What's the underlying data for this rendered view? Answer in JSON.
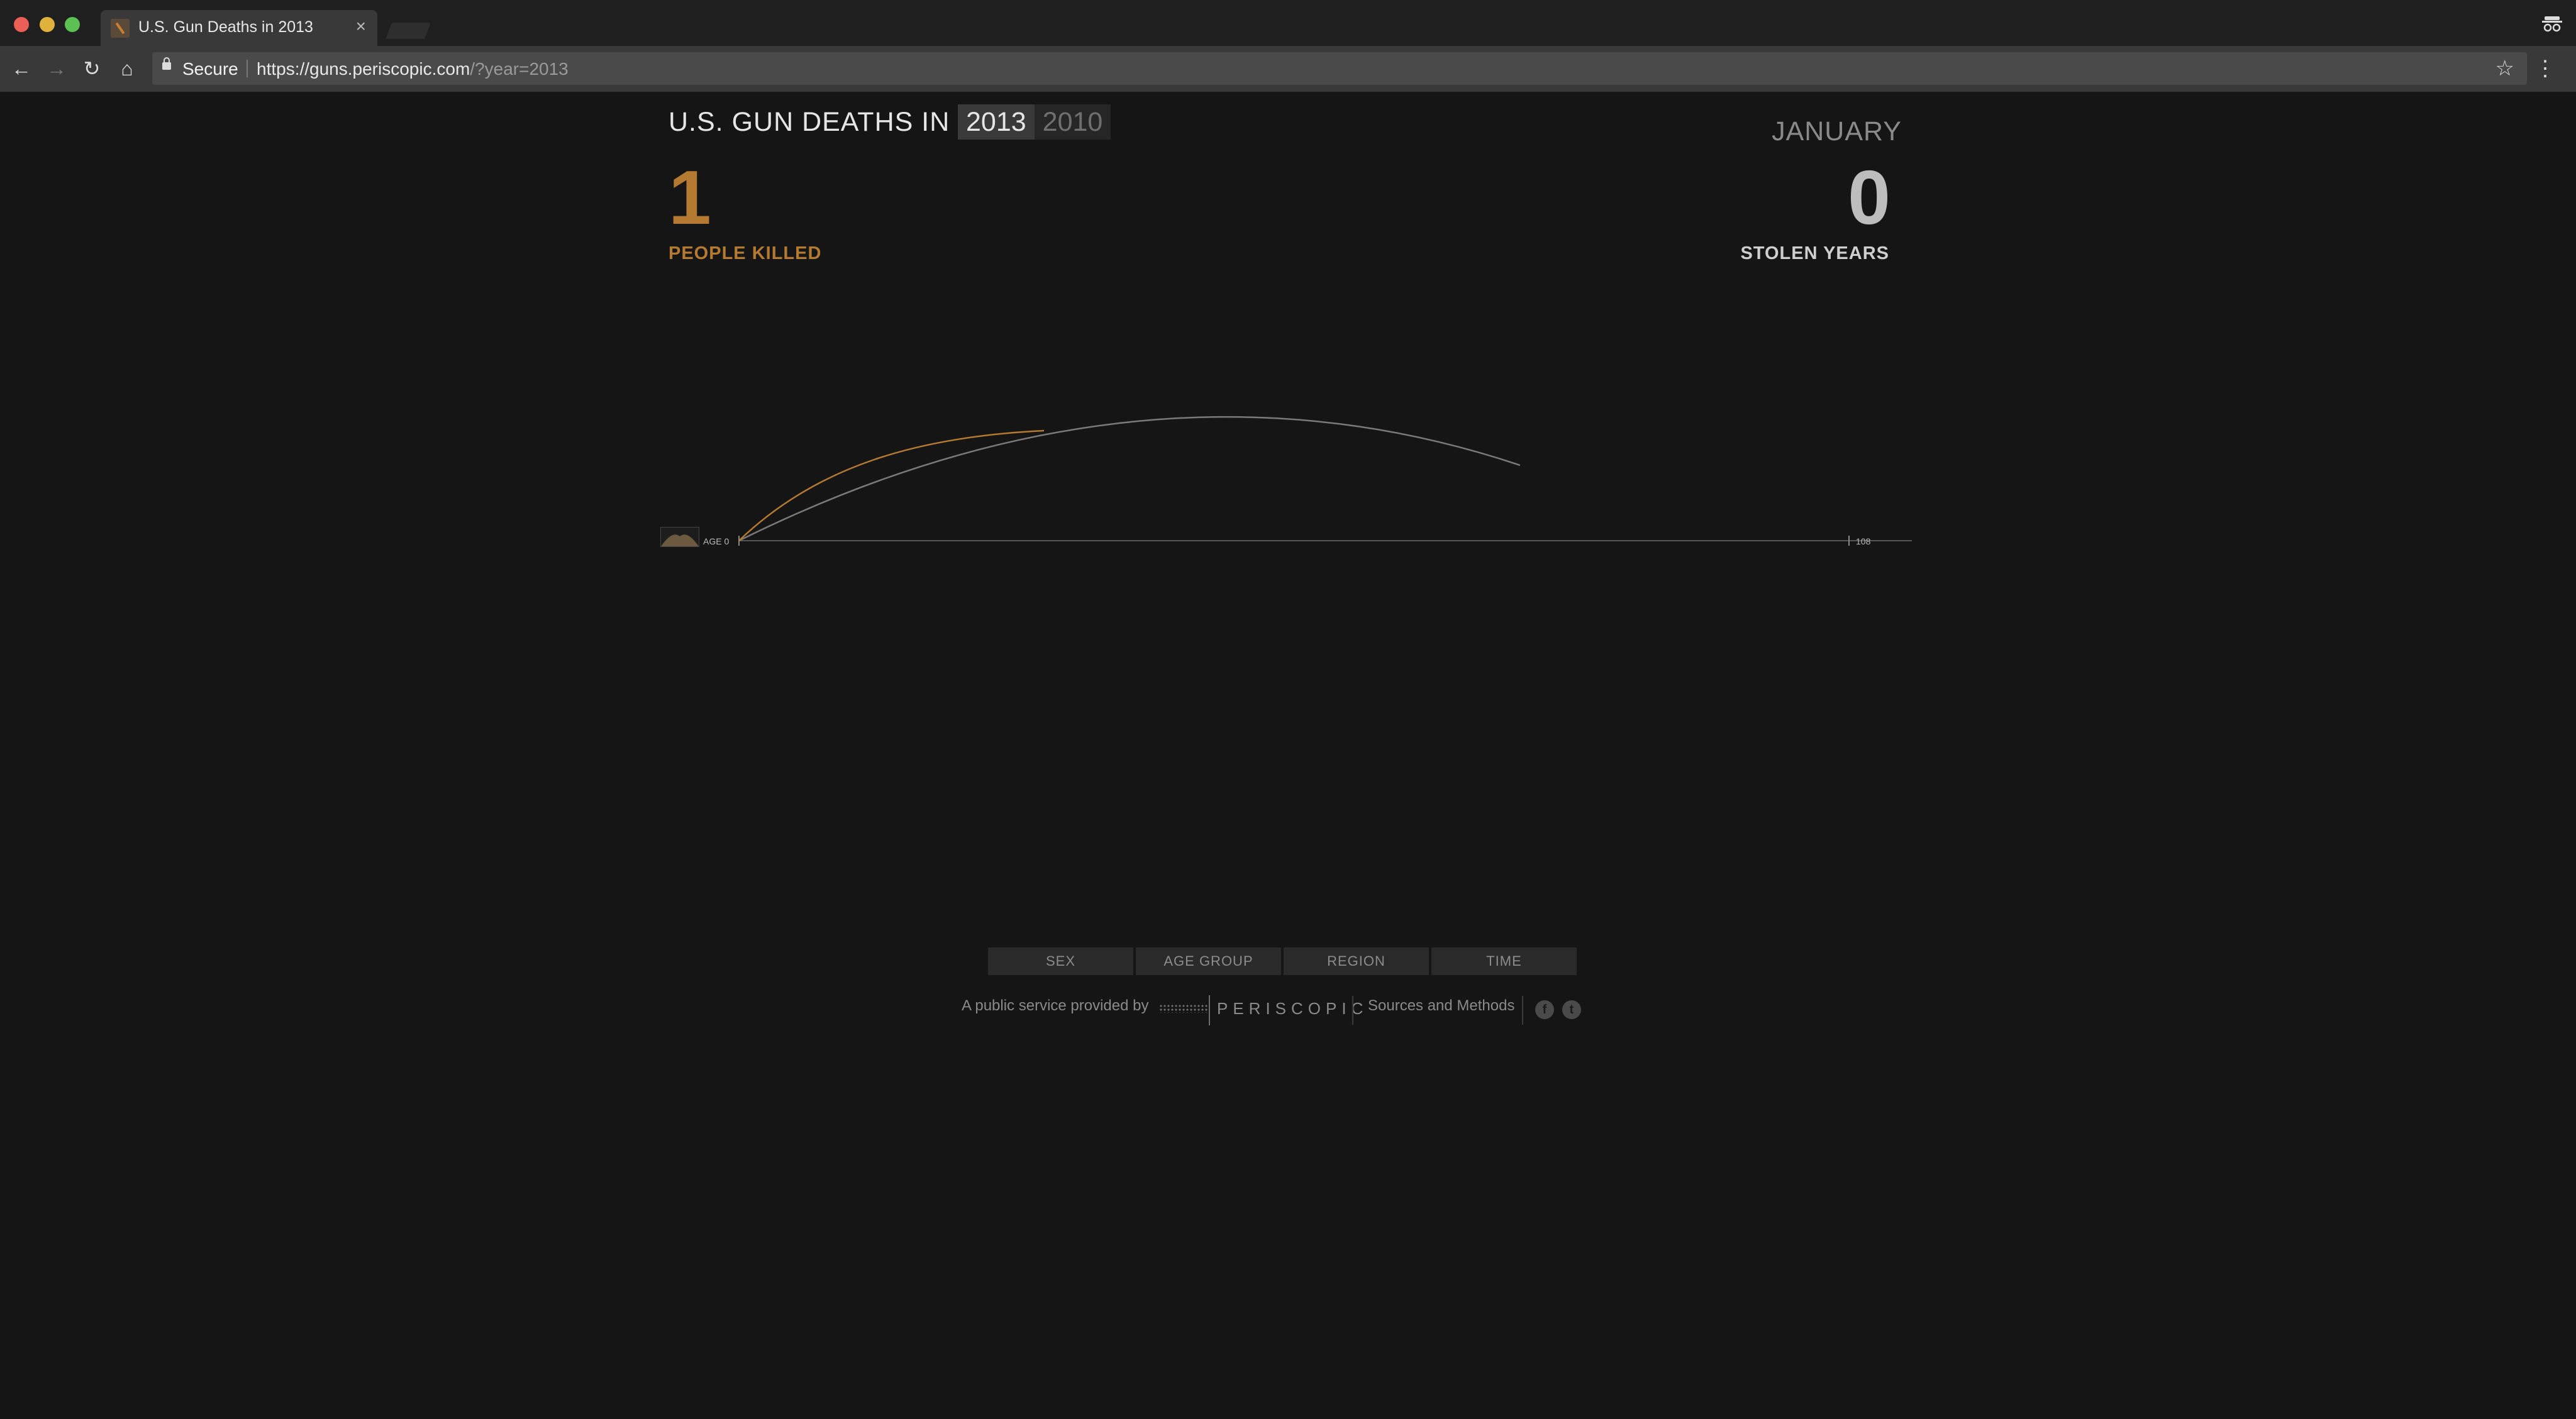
{
  "browser": {
    "tab_title": "U.S. Gun Deaths in 2013",
    "tab_close": "×",
    "secure_label": "Secure",
    "url_main": "https://guns.periscopic.com",
    "url_query": "/?year=2013"
  },
  "header": {
    "headline": "U.S. GUN DEATHS IN",
    "years": [
      "2013",
      "2010"
    ],
    "active_year": "2013",
    "month": "JANUARY"
  },
  "stats": {
    "people_killed": "1",
    "people_killed_label": "PEOPLE KILLED",
    "stolen_years": "0",
    "stolen_years_label": "STOLEN YEARS"
  },
  "chart_data": {
    "type": "line",
    "x_min": 0,
    "x_max": 108,
    "x_min_label": "AGE 0",
    "x_max_label": "108",
    "lines": [
      {
        "segment": "lived",
        "color": "#b57a31"
      },
      {
        "segment": "projected",
        "color": "#7a7a7a"
      }
    ]
  },
  "filters": [
    "SEX",
    "AGE GROUP",
    "REGION",
    "TIME"
  ],
  "footer": {
    "provided_by": "A public service provided by",
    "brand": "PERISCOPIC",
    "sources": "Sources and Methods",
    "social": [
      "f",
      "t"
    ]
  },
  "colors": {
    "accent": "#b57a31",
    "background": "#151515"
  }
}
